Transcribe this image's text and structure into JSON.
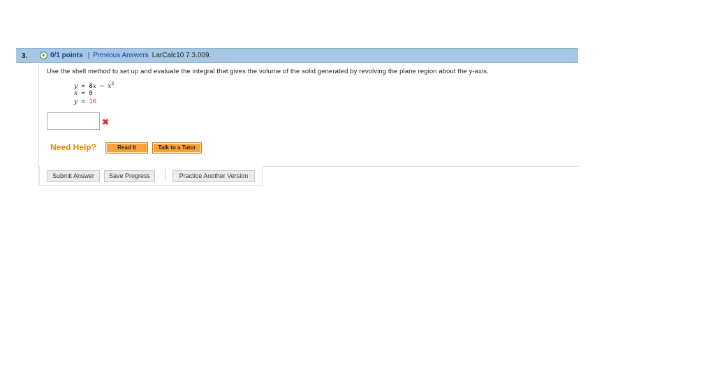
{
  "question": {
    "number": "3.",
    "points": "0/1 points",
    "separator": "|",
    "previous_answers": "Previous Answers",
    "source": "LarCalc10 7.3.009.",
    "prompt": "Use the shell method to set up and evaluate the integral that gives the volume of the solid generated by revolving the plane region about the y-axis.",
    "equations": {
      "eq1": "y = 8x − x²",
      "eq2": "x = 0",
      "eq3": "y = 16"
    },
    "answer_value": "",
    "status_icon": "wrong-x-icon"
  },
  "help": {
    "label": "Need Help?",
    "read_it": "Read It",
    "talk_to_tutor": "Talk to a Tutor"
  },
  "actions": {
    "submit": "Submit Answer",
    "save": "Save Progress",
    "practice": "Practice Another Version"
  },
  "colors": {
    "header_bg": "#a6c8e4",
    "help_orange": "#e08a00",
    "button_orange": "#f9a23a",
    "wrong_red": "#dd3333"
  }
}
